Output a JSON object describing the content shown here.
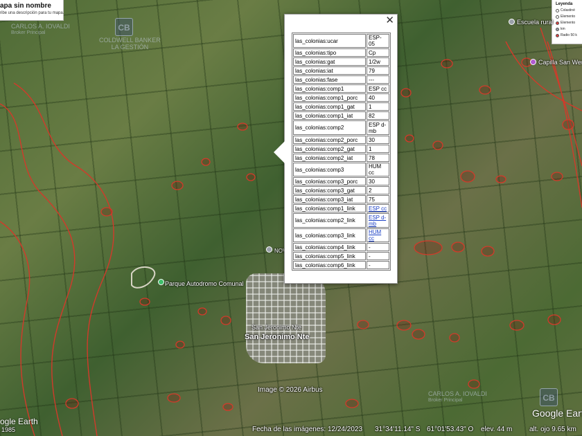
{
  "project": {
    "title": "apa sin nombre",
    "subtitle": "ribe una descripción para tu mapa."
  },
  "legend": {
    "title": "Leyenda",
    "items": [
      {
        "label": "Colastiné",
        "color": "#ffffff"
      },
      {
        "label": "Elemento",
        "color": "#ffffff"
      },
      {
        "label": "Elemento",
        "color": "#e04040"
      },
      {
        "label": "km",
        "color": "#9aa0aa"
      },
      {
        "label": "Radio 50 k",
        "color": "#e04040"
      }
    ]
  },
  "watermarks": {
    "top_left_name": "CARLOS A. IOVALDI",
    "top_left_sub1": "Broker Principal",
    "top_left_brand": "COLDWELL BANKER",
    "top_left_brand2": "LA GESTIÓN",
    "bottom_right_name": "CARLOS A. IOVALDI",
    "bottom_right_sub1": "Broker Principal",
    "logo_text": "CB"
  },
  "places": {
    "escuela": "Escuela rural",
    "capilla": "Capilla San Wend",
    "novo": "NOV",
    "parque": "Parque Autodromo Comunal",
    "town_small": "San Jeronimo Nte",
    "town_large": "San Jeronimo Nte"
  },
  "balloon": {
    "close_label": "✕",
    "rows": [
      {
        "key": "las_colonias:ucar",
        "value": "ESP-05"
      },
      {
        "key": "las_colonias:tipo",
        "value": "Cp"
      },
      {
        "key": "las_colonias:gat",
        "value": "1/2w"
      },
      {
        "key": "las_colonias:iat",
        "value": "79"
      },
      {
        "key": "las_colonias:fase",
        "value": "---"
      },
      {
        "key": "las_colonias:comp1",
        "value": "ESP cc"
      },
      {
        "key": "las_colonias:comp1_porc",
        "value": "40"
      },
      {
        "key": "las_colonias:comp1_gat",
        "value": "1"
      },
      {
        "key": "las_colonias:comp1_iat",
        "value": "82"
      },
      {
        "key": "las_colonias:comp2",
        "value": "ESP d-mb"
      },
      {
        "key": "las_colonias:comp2_porc",
        "value": "30"
      },
      {
        "key": "las_colonias:comp2_gat",
        "value": "1"
      },
      {
        "key": "las_colonias:comp2_iat",
        "value": "78"
      },
      {
        "key": "las_colonias:comp3",
        "value": "HUM cc"
      },
      {
        "key": "las_colonias:comp3_porc",
        "value": "30"
      },
      {
        "key": "las_colonias:comp3_gat",
        "value": "2"
      },
      {
        "key": "las_colonias:comp3_iat",
        "value": "75"
      },
      {
        "key": "las_colonias:comp1_link",
        "value": "ESP cc",
        "link": true
      },
      {
        "key": "las_colonias:comp2_link",
        "value": "ESP d-mb",
        "link": true
      },
      {
        "key": "las_colonias:comp3_link",
        "value": "HUM cc",
        "link": true
      },
      {
        "key": "las_colonias:comp4_link",
        "value": "-"
      },
      {
        "key": "las_colonias:comp5_link",
        "value": "-"
      },
      {
        "key": "las_colonias:comp6_link",
        "value": "-"
      }
    ]
  },
  "attribution": {
    "image_credit": "Image © 2026 Airbus",
    "google_earth_left": "ogle Earth",
    "year_left": "1985",
    "google_earth_right": "Google Earth"
  },
  "status": {
    "imagery_date": "Fecha de las imágenes: 12/24/2023",
    "latitude": "31°34'11.14\" S",
    "longitude": "61°01'53.43\" O",
    "elevation": "elev.   44 m",
    "eye_alt": "alt. ojo  9.65 km"
  },
  "colors": {
    "soil_outline": "#d23a2a",
    "pin_green": "#3fbf6a",
    "pin_purple": "#b05ad0",
    "link": "#1a3fc4"
  }
}
